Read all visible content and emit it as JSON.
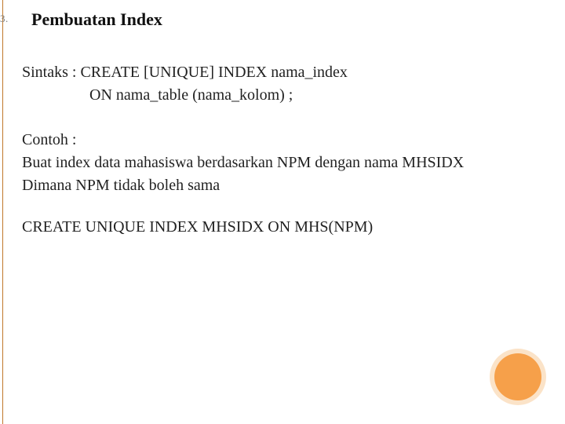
{
  "slide": {
    "number": "3.",
    "title": "Pembuatan Index",
    "syntax": {
      "line1": "Sintaks : CREATE [UNIQUE] INDEX  nama_index",
      "line2": "ON nama_table (nama_kolom) ;"
    },
    "example": {
      "label": "Contoh :",
      "line1": "Buat index data mahasiswa berdasarkan NPM dengan nama MHSIDX",
      "line2": "Dimana NPM tidak boleh sama",
      "sql": "CREATE UNIQUE  INDEX MHSIDX ON MHS(NPM)"
    }
  }
}
